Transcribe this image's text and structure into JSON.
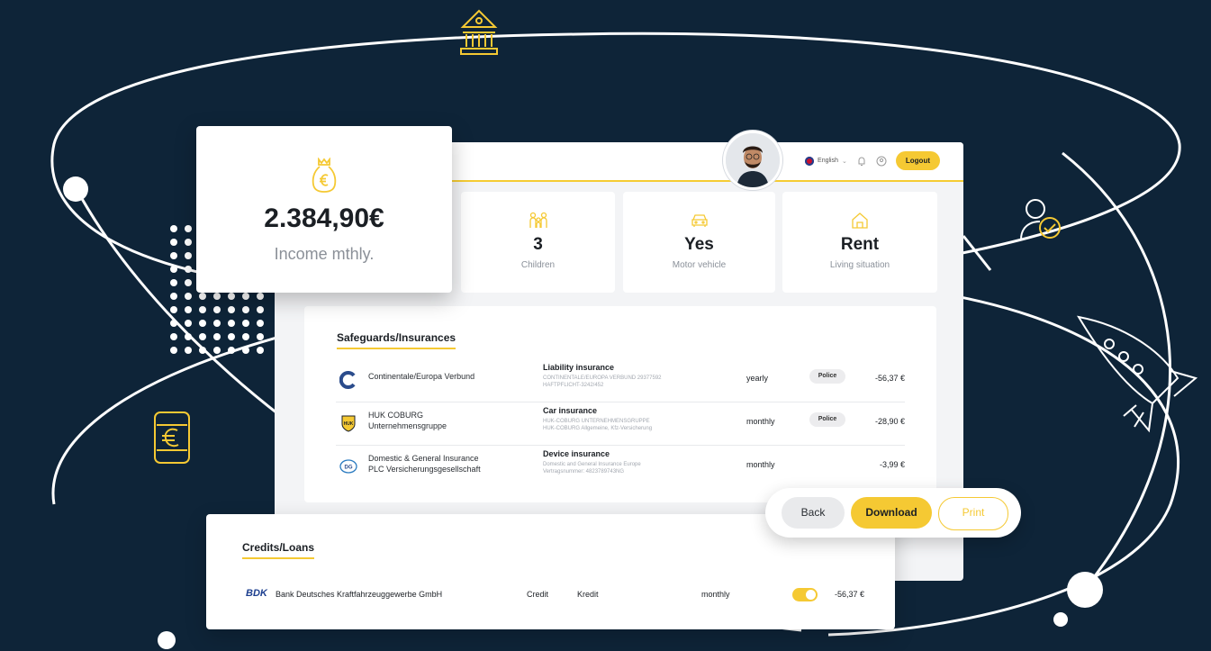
{
  "colors": {
    "background": "#0e2438",
    "accent": "#f5c933",
    "card": "#ffffff",
    "muted_text": "#8b9098"
  },
  "header": {
    "language": "English",
    "logout_label": "Logout",
    "icons": [
      "globe-flag-icon",
      "bell-icon",
      "user-circle-icon"
    ]
  },
  "income": {
    "amount": "2.384,90€",
    "label": "Income mthly.",
    "icon": "money-bag-euro-icon"
  },
  "stats": [
    {
      "value": "3",
      "label": "Children",
      "icon": "family-icon"
    },
    {
      "value": "Yes",
      "label": "Motor vehicle",
      "icon": "car-icon"
    },
    {
      "value": "Rent",
      "label": "Living situation",
      "icon": "house-icon"
    }
  ],
  "insurances": {
    "title": "Safeguards/Insurances",
    "rows": [
      {
        "company": [
          "Continentale/Europa Verbund"
        ],
        "type": "Liability insurance",
        "detail": [
          "CONTINENTALE/EUROPA VERBUND 29377592",
          "HAFTPFLICHT-3242/452"
        ],
        "frequency": "yearly",
        "badge": "Police",
        "amount": "-56,37 €"
      },
      {
        "company": [
          "HUK COBURG",
          "Unternehmensgruppe"
        ],
        "type": "Car insurance",
        "detail": [
          "HUK-COBURG UNTERNEHMENSGRUPPE",
          "HUK-COBURG Allgemeine, Kfz-Versicherung"
        ],
        "frequency": "monthly",
        "badge": "Police",
        "amount": "-28,90 €"
      },
      {
        "company": [
          "Domestic & General Insurance",
          "PLC Versicherungsgesellschaft"
        ],
        "type": "Device insurance",
        "detail": [
          "Domestic and General Insurance Europe",
          "Vertragsnummer: 4823789743NG"
        ],
        "frequency": "monthly",
        "badge": "",
        "amount": "-3,99 €"
      }
    ]
  },
  "credits": {
    "title": "Credits/Loans",
    "row": {
      "logo": "BDK",
      "bank": "Bank Deutsches Kraftfahrzeuggewerbe GmbH",
      "category": "Credit",
      "type": "Kredit",
      "frequency": "monthly",
      "toggle_on": true,
      "amount": "-56,37 €"
    }
  },
  "actions": {
    "back": "Back",
    "download": "Download",
    "print": "Print"
  }
}
